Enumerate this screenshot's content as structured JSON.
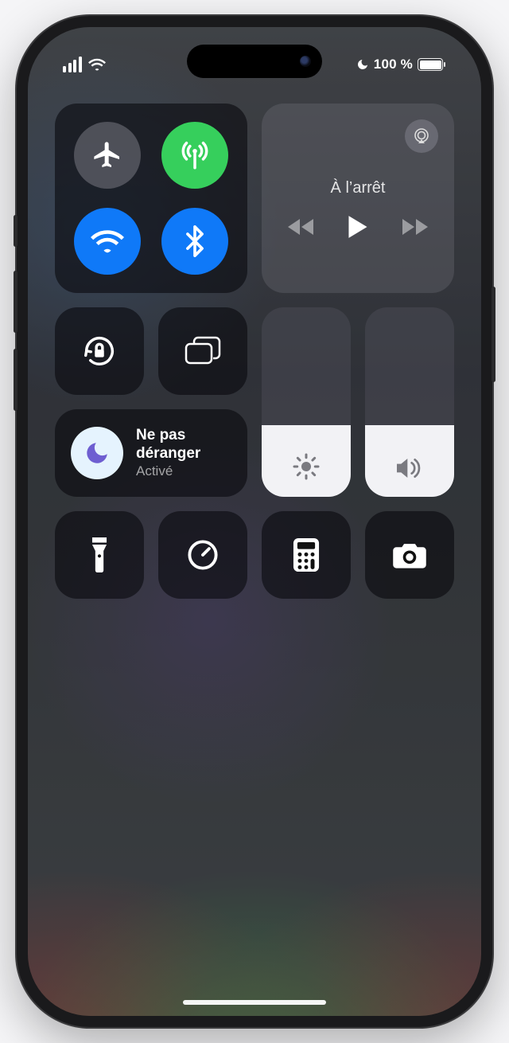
{
  "status": {
    "battery_text": "100 %",
    "battery_level": 100
  },
  "connectivity": {
    "airplane": {
      "enabled": false,
      "icon": "airplane-icon"
    },
    "cellular": {
      "enabled": true,
      "icon": "antenna-icon"
    },
    "wifi": {
      "enabled": true,
      "icon": "wifi-icon"
    },
    "bluetooth": {
      "enabled": true,
      "icon": "bluetooth-icon"
    }
  },
  "media": {
    "title": "À l’arrêt",
    "airplay_icon": "airplay-icon"
  },
  "orientation_lock": {
    "locked": false
  },
  "screen_mirroring": {
    "icon": "screen-mirroring-icon"
  },
  "focus": {
    "name": "Ne pas déranger",
    "state": "Activé",
    "icon": "moon-icon",
    "active": true
  },
  "sliders": {
    "brightness": {
      "level_percent": 38,
      "icon": "sun-icon"
    },
    "volume": {
      "level_percent": 38,
      "icon": "speaker-icon"
    }
  },
  "shortcuts": [
    {
      "id": "flashlight",
      "icon": "flashlight-icon"
    },
    {
      "id": "timer",
      "icon": "timer-icon"
    },
    {
      "id": "calculator",
      "icon": "calculator-icon"
    },
    {
      "id": "camera",
      "icon": "camera-icon"
    }
  ],
  "colors": {
    "toggle_blue": "#0a7aff",
    "toggle_green": "#30d158",
    "moon_purple": "#6e5dd6"
  }
}
